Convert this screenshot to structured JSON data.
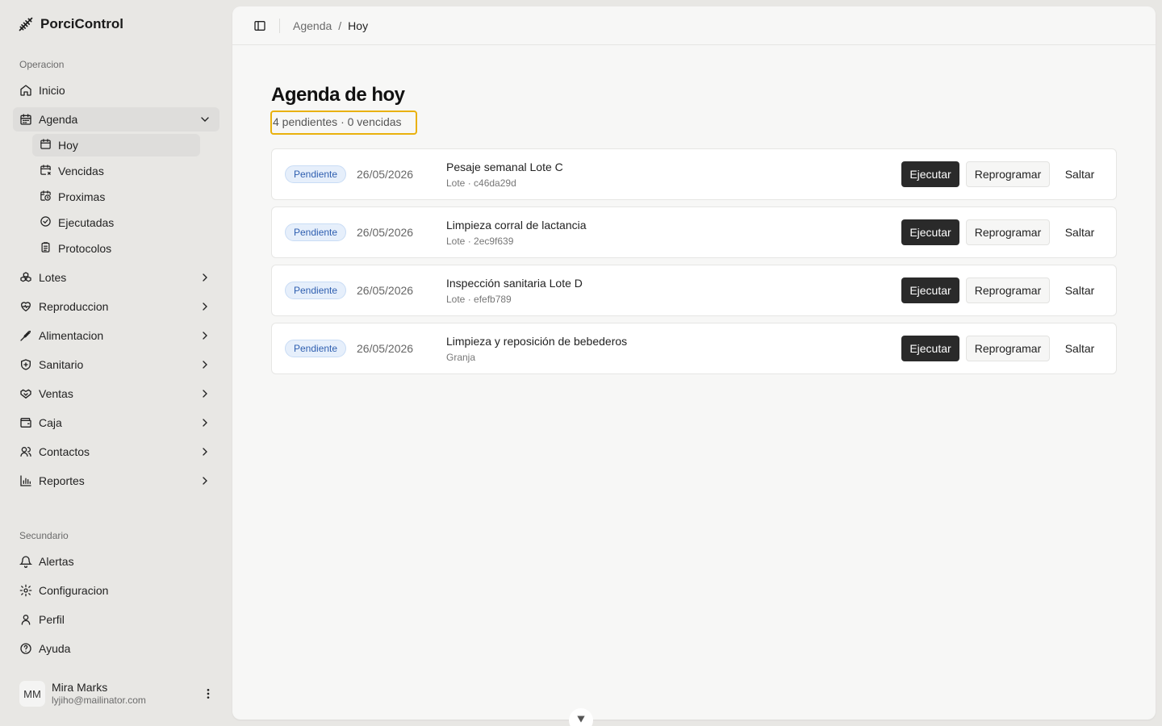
{
  "app": {
    "name": "PorciControl"
  },
  "sidebar": {
    "section_operacion": "Operacion",
    "section_secundario": "Secundario",
    "items": {
      "inicio": "Inicio",
      "agenda": "Agenda",
      "lotes": "Lotes",
      "reproduccion": "Reproduccion",
      "alimentacion": "Alimentacion",
      "sanitario": "Sanitario",
      "ventas": "Ventas",
      "caja": "Caja",
      "contactos": "Contactos",
      "reportes": "Reportes"
    },
    "agenda_sub": {
      "hoy": "Hoy",
      "vencidas": "Vencidas",
      "proximas": "Proximas",
      "ejecutadas": "Ejecutadas",
      "protocolos": "Protocolos"
    },
    "secondary": {
      "alertas": "Alertas",
      "configuracion": "Configuracion",
      "perfil": "Perfil",
      "ayuda": "Ayuda"
    },
    "user": {
      "initials": "MM",
      "name": "Mira Marks",
      "email": "lyjiho@mailinator.com"
    }
  },
  "header": {
    "breadcrumb_parent": "Agenda",
    "breadcrumb_sep": "/",
    "breadcrumb_current": "Hoy"
  },
  "page": {
    "title": "Agenda de hoy",
    "summary": "4 pendientes · 0 vencidas",
    "actions": {
      "execute": "Ejecutar",
      "reschedule": "Reprogramar",
      "skip": "Saltar"
    },
    "tasks": [
      {
        "status": "Pendiente",
        "date": "26/05/2026",
        "title": "Pesaje semanal Lote C",
        "subtitle": "Lote · c46da29d"
      },
      {
        "status": "Pendiente",
        "date": "26/05/2026",
        "title": "Limpieza corral de lactancia",
        "subtitle": "Lote · 2ec9f639"
      },
      {
        "status": "Pendiente",
        "date": "26/05/2026",
        "title": "Inspección sanitaria Lote D",
        "subtitle": "Lote · efefb789"
      },
      {
        "status": "Pendiente",
        "date": "26/05/2026",
        "title": "Limpieza y reposición de bebederos",
        "subtitle": "Granja"
      }
    ]
  },
  "colors": {
    "accent_dark": "#2a2a2a",
    "badge_blue": "#2f5fb0",
    "highlight": "#e9b10d"
  }
}
